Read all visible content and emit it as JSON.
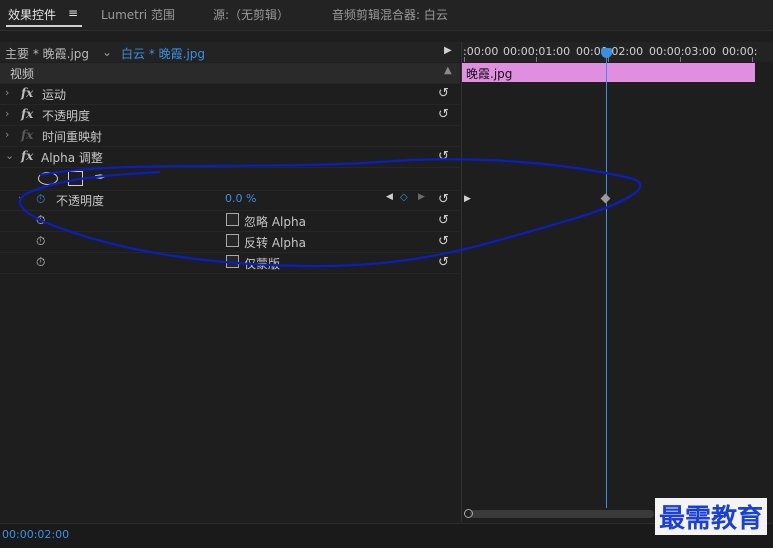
{
  "tabs": [
    {
      "label": "效果控件",
      "active": true
    },
    {
      "label": "Lumetri 范围",
      "active": false
    },
    {
      "label": "源:（无剪辑）",
      "active": false
    },
    {
      "label": "音频剪辑混合器: 白云",
      "active": false
    }
  ],
  "tab_menu_icon": "≡",
  "sequence": {
    "master": "主要 * 晚霞.jpg",
    "active": "白云 * 晚霞.jpg"
  },
  "section": {
    "label": "视频"
  },
  "effects": [
    {
      "label": "运动",
      "enabled": true
    },
    {
      "label": "不透明度",
      "enabled": true
    },
    {
      "label": "时间重映射",
      "enabled": false
    },
    {
      "label": "Alpha 调整",
      "enabled": true
    }
  ],
  "alpha": {
    "opacity_label": "不透明度",
    "opacity_value": "0.0 %",
    "ignore_alpha": "忽略 Alpha",
    "invert_alpha": "反转 Alpha",
    "mask_only": "仅蒙版"
  },
  "timeline": {
    "ruler": [
      ":00:00",
      "00:00:01:00",
      "00:00:02:00",
      "00:00:03:00",
      "00:00:"
    ],
    "clip_label": "晚霞.jpg",
    "playhead_time": "00:00:02:00"
  },
  "current_timecode": "00:00:02:00",
  "watermark": "最需教育",
  "colors": {
    "accent": "#3c8fe0",
    "clip": "#e08fe0",
    "annotation": "#0a1fbf"
  }
}
